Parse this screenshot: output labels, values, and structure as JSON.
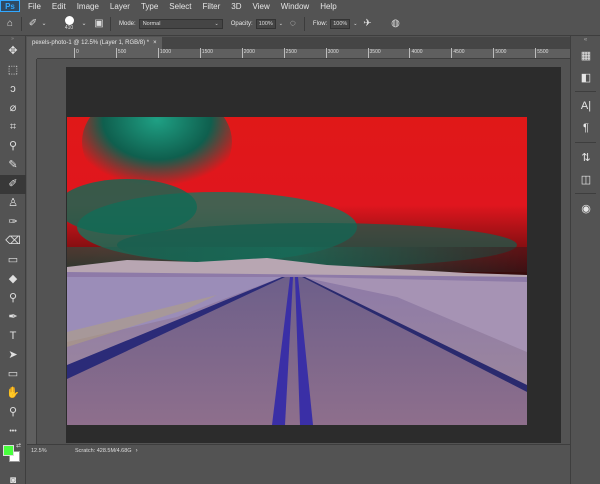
{
  "app": {
    "logo": "Ps",
    "menu": [
      "File",
      "Edit",
      "Image",
      "Layer",
      "Type",
      "Select",
      "Filter",
      "3D",
      "View",
      "Window",
      "Help"
    ]
  },
  "options": {
    "brush_size": "410",
    "mode_label": "Mode:",
    "mode_value": "Normal",
    "opacity_label": "Opacity:",
    "opacity_value": "100%",
    "flow_label": "Flow:",
    "flow_value": "100%"
  },
  "document": {
    "tab_title": "pexels-photo-1 @ 12.5% (Layer 1, RGB/8) *",
    "tab_close": "×"
  },
  "ruler": {
    "labels": [
      "0",
      "500",
      "1000",
      "1500",
      "2000",
      "2500",
      "3000",
      "3500",
      "4000",
      "4500",
      "5000",
      "5500"
    ]
  },
  "status": {
    "zoom": "12.5%",
    "scratch": "Scratch: 428.5M/4.68G",
    "arrow": "›"
  },
  "colors": {
    "foreground": "#49ff3e",
    "background": "#ffffff",
    "ui_bg": "#535353",
    "canvas_bg": "#2c2c2c"
  },
  "tools": [
    {
      "name": "move-tool",
      "icon": "move-icon",
      "glyph": "✥"
    },
    {
      "name": "marquee-tool",
      "icon": "marquee-icon",
      "glyph": "⬚"
    },
    {
      "name": "lasso-tool",
      "icon": "lasso-icon",
      "glyph": "ↄ"
    },
    {
      "name": "quick-select-tool",
      "icon": "quick-select-icon",
      "glyph": "⌀"
    },
    {
      "name": "crop-tool",
      "icon": "crop-icon",
      "glyph": "⌗"
    },
    {
      "name": "eyedropper-tool",
      "icon": "eyedropper-icon",
      "glyph": "⚲"
    },
    {
      "name": "healing-brush-tool",
      "icon": "bandage-icon",
      "glyph": "✎"
    },
    {
      "name": "brush-tool",
      "icon": "brush-icon",
      "glyph": "✐",
      "active": true
    },
    {
      "name": "clone-stamp-tool",
      "icon": "stamp-icon",
      "glyph": "♙"
    },
    {
      "name": "history-brush-tool",
      "icon": "history-brush-icon",
      "glyph": "✑"
    },
    {
      "name": "eraser-tool",
      "icon": "eraser-icon",
      "glyph": "⌫"
    },
    {
      "name": "gradient-tool",
      "icon": "gradient-icon",
      "glyph": "▭"
    },
    {
      "name": "blur-tool",
      "icon": "blur-icon",
      "glyph": "◆"
    },
    {
      "name": "dodge-tool",
      "icon": "dodge-icon",
      "glyph": "⚲"
    },
    {
      "name": "pen-tool",
      "icon": "pen-icon",
      "glyph": "✒"
    },
    {
      "name": "type-tool",
      "icon": "type-icon",
      "glyph": "T"
    },
    {
      "name": "path-select-tool",
      "icon": "path-select-icon",
      "glyph": "➤"
    },
    {
      "name": "shape-tool",
      "icon": "rectangle-icon",
      "glyph": "▭"
    },
    {
      "name": "hand-tool",
      "icon": "hand-icon",
      "glyph": "✋"
    },
    {
      "name": "zoom-tool",
      "icon": "zoom-icon",
      "glyph": "⚲"
    },
    {
      "name": "more-tools",
      "icon": "more-icon",
      "glyph": "•••"
    }
  ],
  "dock": [
    {
      "name": "libraries-panel-button",
      "icon": "libraries-icon",
      "glyph": "▦"
    },
    {
      "name": "color-panel-button",
      "icon": "color-icon",
      "glyph": "◧"
    },
    {
      "name": "character-panel-button",
      "icon": "character-icon",
      "glyph": "A|"
    },
    {
      "name": "paragraph-panel-button",
      "icon": "paragraph-icon",
      "glyph": "¶"
    },
    {
      "name": "adjustments-panel-button",
      "icon": "adjustments-icon",
      "glyph": "⇅"
    },
    {
      "name": "layers-panel-button",
      "icon": "layers-icon",
      "glyph": "◫"
    },
    {
      "name": "channels-panel-button",
      "icon": "channels-icon",
      "glyph": "◉"
    }
  ]
}
